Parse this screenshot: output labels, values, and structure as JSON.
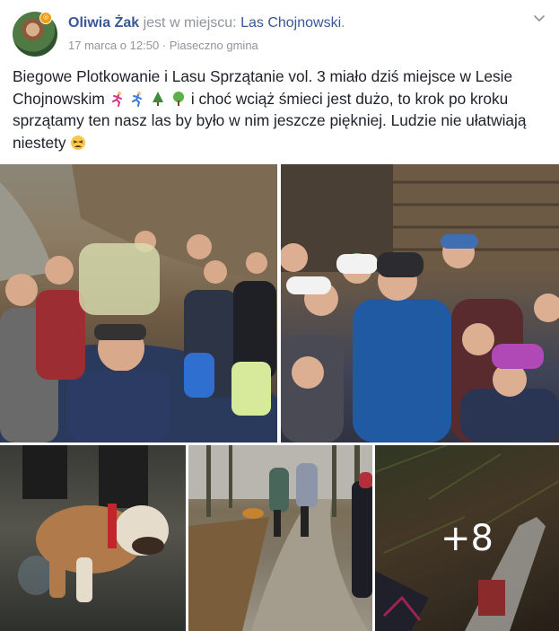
{
  "post": {
    "author": "Oliwia Żak",
    "checkin_prefix": "jest w miejscu:",
    "place": "Las Chojnowski",
    "place_suffix": ".",
    "date": "17 marca o 12:50",
    "separator": "·",
    "location": "Piaseczno gmina",
    "text_1": "Biegowe Plotkowanie i Lasu Sprzątanie vol. 3 miało dziś miejsce w Lesie Chojnowskim",
    "text_2": " i choć wciąż śmieci jest dużo, to krok po kroku sprzątamy ten nasz las by było w nim jeszcze piękniej. Ludzie nie ułatwiają niestety ",
    "emojis": [
      "runner-emoji",
      "runner-emoji",
      "evergreen-tree-emoji",
      "deciduous-tree-emoji",
      "tired-face-emoji"
    ],
    "more_photos": "+8"
  },
  "colors": {
    "link": "#385898",
    "muted": "#90949c",
    "text": "#1d2129"
  }
}
